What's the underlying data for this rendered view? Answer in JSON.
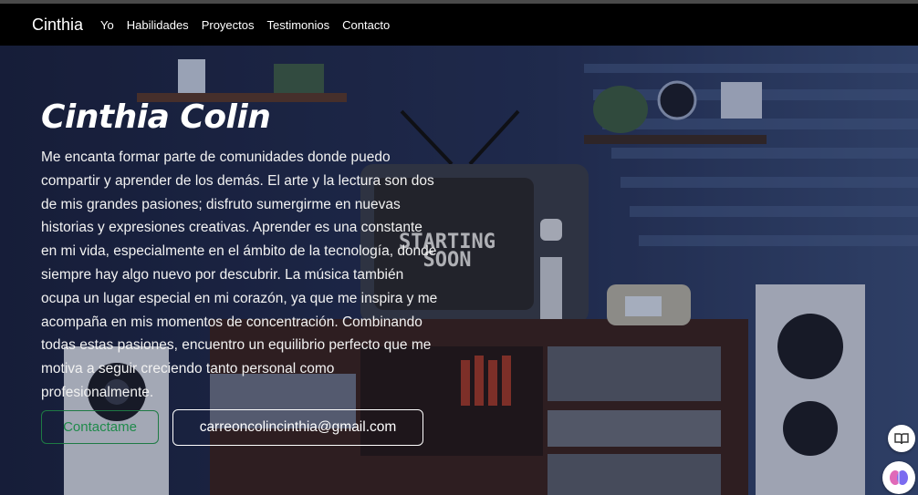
{
  "navbar": {
    "brand": "Cinthia",
    "links": [
      "Yo",
      "Habilidades",
      "Proyectos",
      "Testimonios",
      "Contacto"
    ]
  },
  "hero": {
    "title": "Cinthia Colin",
    "bio": "Me encanta formar parte de comunidades donde puedo compartir y aprender de los demás. El arte y la lectura son dos de mis grandes pasiones; disfruto sumergirme en nuevas historias y expresiones creativas. Aprender es una constante en mi vida, especialmente en el ámbito de la tecnología, donde siempre hay algo nuevo por descubrir. La música también ocupa un lugar especial en mi corazón, ya que me inspira y me acompaña en mis momentos de concentración. Combinando todas estas pasiones, encuentro un equilibrio perfecto que me motiva a seguir creciendo tanto personal como profesionalmente.",
    "contact_button": "Contactame",
    "email_button": "carreoncolincinthia@gmail.com",
    "tv_screen_text_1": "STARTING",
    "tv_screen_text_2": "SOON"
  },
  "floating": {
    "reader_icon": "book-icon",
    "assistant_icon": "brain-icon"
  },
  "colors": {
    "navbar": "#000000",
    "accent_green": "#1f8a4b",
    "background_blue": "#1b2542"
  }
}
